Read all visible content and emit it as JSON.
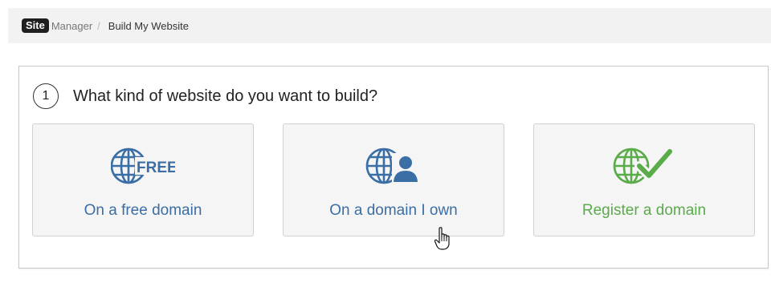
{
  "breadcrumb": {
    "logo_text": "Site",
    "manager_label": "Manager",
    "separator": "/",
    "current_label": "Build My Website"
  },
  "wizard": {
    "step_number": "1",
    "question": "What kind of website do you want to build?",
    "options": [
      {
        "label": "On a free domain",
        "icon": "globe-free-icon",
        "icon_text": "FREE",
        "color": "#3a6ea5"
      },
      {
        "label": "On a domain I own",
        "icon": "globe-person-icon",
        "color": "#3a6ea5"
      },
      {
        "label": "Register a domain",
        "icon": "globe-check-icon",
        "color": "#5aab4a"
      }
    ]
  },
  "cursor": {
    "type": "hand-pointer-icon"
  }
}
